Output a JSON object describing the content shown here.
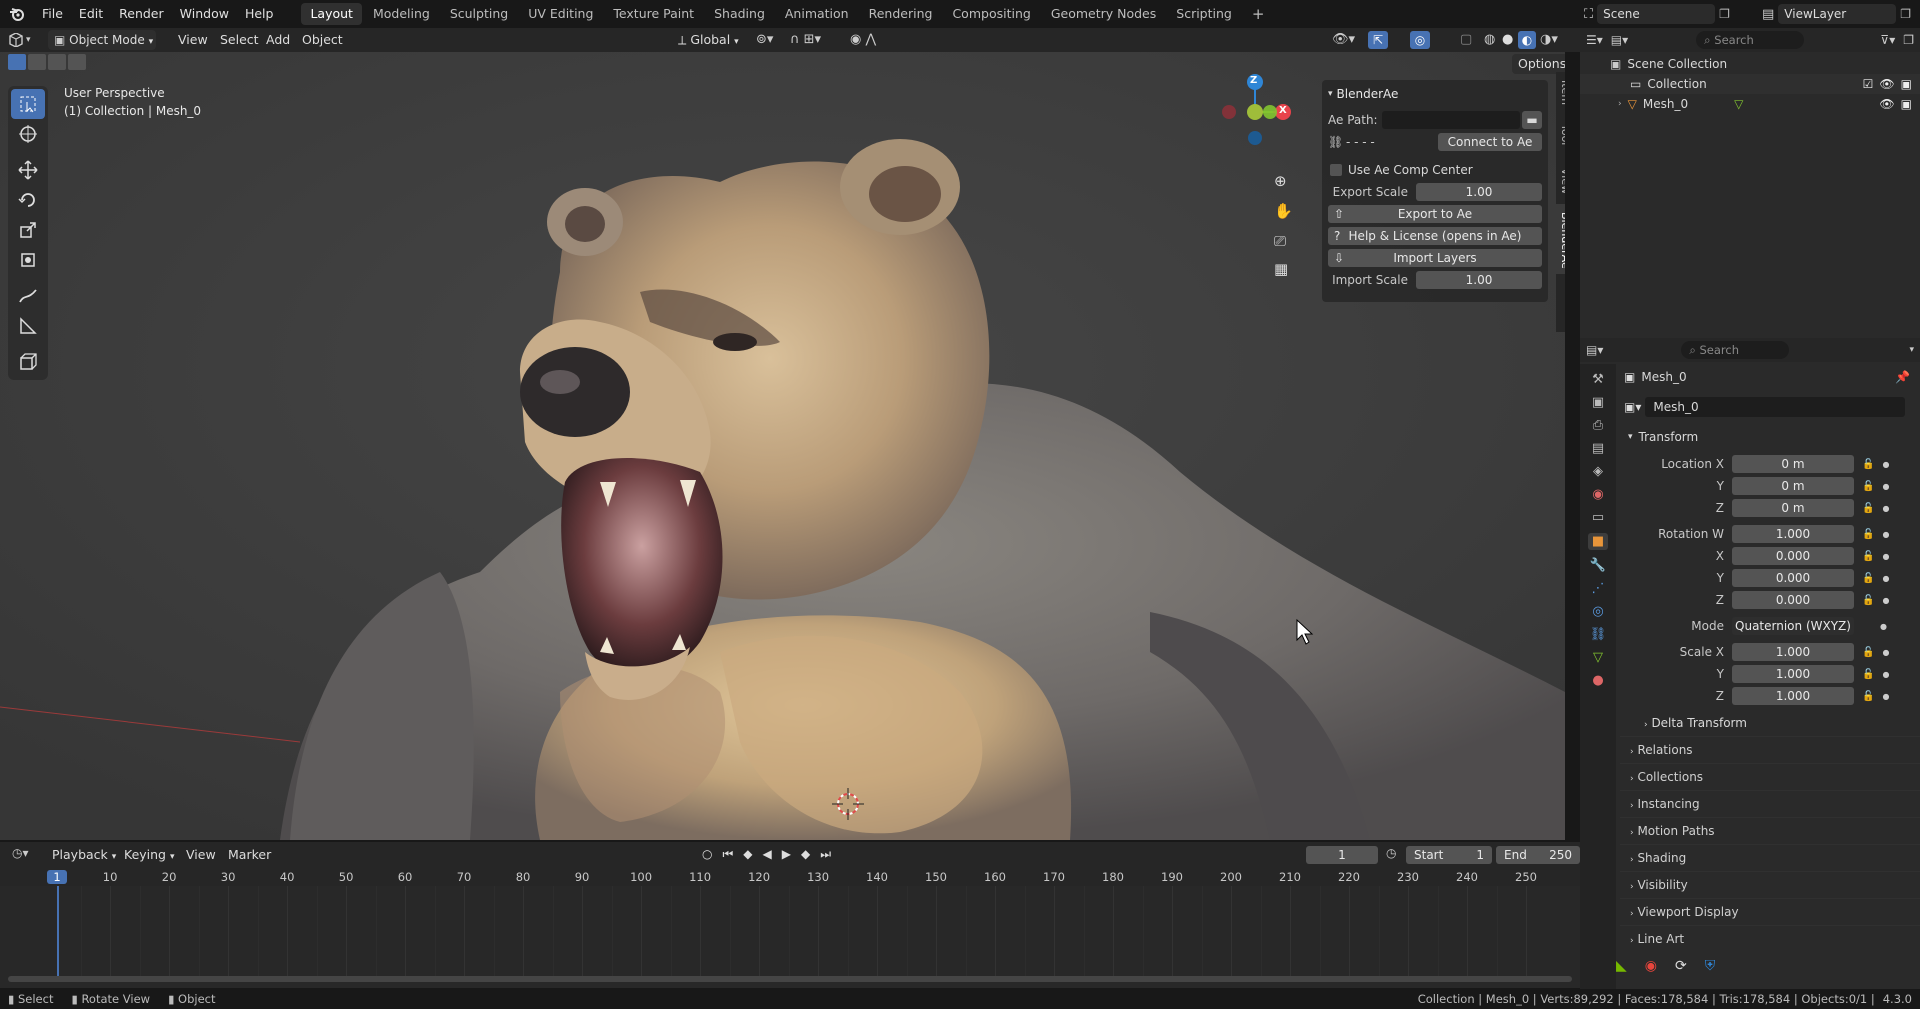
{
  "menubar": {
    "items": [
      "File",
      "Edit",
      "Render",
      "Window",
      "Help"
    ],
    "workspaces": [
      "Layout",
      "Modeling",
      "Sculpting",
      "UV Editing",
      "Texture Paint",
      "Shading",
      "Animation",
      "Rendering",
      "Compositing",
      "Geometry Nodes",
      "Scripting"
    ],
    "active_workspace": "Layout",
    "add_tab": "+",
    "scene": "Scene",
    "view_layer": "ViewLayer"
  },
  "viewport_header": {
    "mode": "Object Mode",
    "menus": [
      "View",
      "Select",
      "Add",
      "Object"
    ],
    "orientation": "Global",
    "options": "Options"
  },
  "viewport": {
    "perspective": "User Perspective",
    "context": "(1) Collection | Mesh_0",
    "side_tabs": [
      "Item",
      "Tool",
      "View",
      "BlenderAe"
    ],
    "gizmo_axes": {
      "z": "Z",
      "x": "X"
    }
  },
  "blenderae_panel": {
    "title": "BlenderAe",
    "ae_path_label": "Ae Path:",
    "ae_path_value": "",
    "status": "- - - -",
    "connect": "Connect to Ae",
    "use_comp_center": "Use Ae Comp Center",
    "export_scale_label": "Export Scale",
    "export_scale": "1.00",
    "export": "Export to Ae",
    "help": "Help & License (opens in Ae)",
    "import_layers": "Import Layers",
    "import_scale_label": "Import Scale",
    "import_scale": "1.00"
  },
  "outliner": {
    "search_placeholder": "Search",
    "scene_collection": "Scene Collection",
    "collection": "Collection",
    "mesh": "Mesh_0"
  },
  "properties": {
    "search_placeholder": "Search",
    "object_name": "Mesh_0",
    "datablock": "Mesh_0",
    "transform_title": "Transform",
    "location": {
      "label_x": "Location X",
      "label_y": "Y",
      "label_z": "Z",
      "x": "0 m",
      "y": "0 m",
      "z": "0 m"
    },
    "rotation": {
      "label_w": "Rotation W",
      "label_x": "X",
      "label_y": "Y",
      "label_z": "Z",
      "w": "1.000",
      "x": "0.000",
      "y": "0.000",
      "z": "0.000"
    },
    "mode_label": "Mode",
    "mode_value": "Quaternion (WXYZ)",
    "scale": {
      "label_x": "Scale X",
      "label_y": "Y",
      "label_z": "Z",
      "x": "1.000",
      "y": "1.000",
      "z": "1.000"
    },
    "delta": "Delta Transform",
    "sections": [
      "Relations",
      "Collections",
      "Instancing",
      "Motion Paths",
      "Shading",
      "Visibility",
      "Viewport Display",
      "Line Art"
    ]
  },
  "timeline": {
    "menus": [
      "Playback",
      "Keying",
      "View",
      "Marker"
    ],
    "current_frame": "1",
    "start_label": "Start",
    "start": "1",
    "end_label": "End",
    "end": "250",
    "ruler": [
      "1",
      "10",
      "20",
      "30",
      "40",
      "50",
      "60",
      "70",
      "80",
      "90",
      "100",
      "110",
      "120",
      "130",
      "140",
      "150",
      "160",
      "170",
      "180",
      "190",
      "200",
      "210",
      "220",
      "230",
      "240",
      "250"
    ]
  },
  "statusbar": {
    "hints": [
      "Select",
      "Rotate View",
      "Object"
    ],
    "stats": "Collection | Mesh_0 | Verts:89,292 | Faces:178,584 | Tris:178,584 | Objects:0/1 |",
    "version": "4.3.0"
  },
  "colors": {
    "accent": "#4772b3",
    "x_axis": "#e8434b",
    "y_axis": "#82c430",
    "z_axis": "#2f86d6",
    "orange": "#e8953a"
  }
}
